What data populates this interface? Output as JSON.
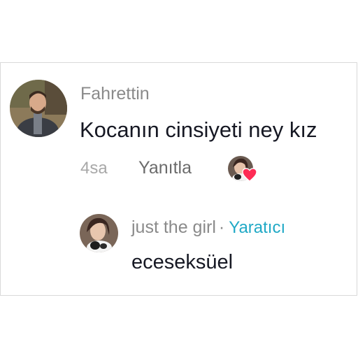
{
  "comment": {
    "username": "Fahrettin",
    "text": "Kocanın cinsiyeti ney kız",
    "time": "4sa",
    "reply_label": "Yanıtla",
    "avatar_icon": "user-avatar-photo"
  },
  "reply": {
    "username": "just the girl",
    "separator": "·",
    "badge": "Yaratıcı",
    "text": "eceseksüel",
    "avatar_icon": "creator-avatar-photo"
  },
  "creator_like": {
    "icon": "creator-liked-heart-icon",
    "heart_color": "#fe2c55"
  },
  "colors": {
    "muted": "#8a8a8a",
    "text": "#161823",
    "creator_badge": "#20a9c6"
  }
}
